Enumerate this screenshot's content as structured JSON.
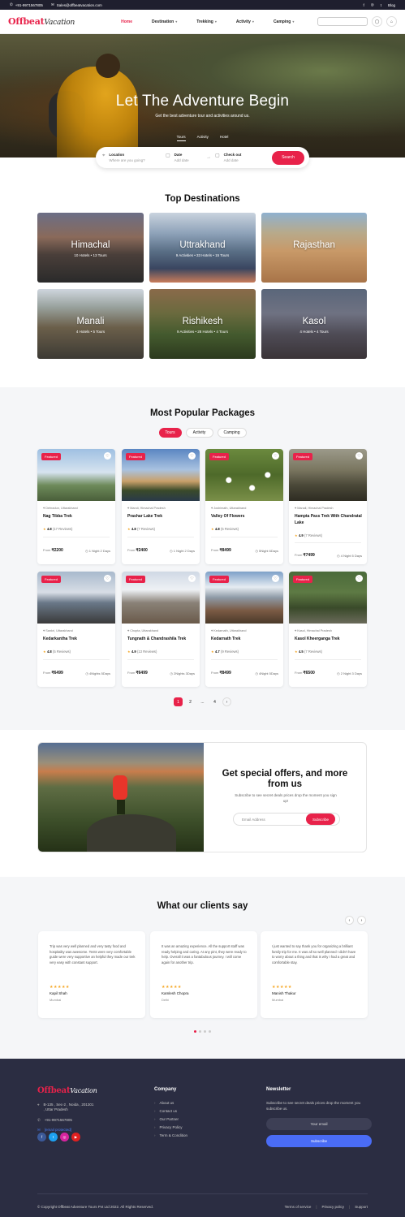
{
  "topbar": {
    "phone": "+91-9971567805",
    "email": "Sales@offbeatvacation.com",
    "social": [
      "f",
      "◎",
      "t"
    ],
    "blog": "Blog"
  },
  "nav": {
    "logo_main": "Offbeat",
    "logo_sub": "Vacation",
    "items": [
      {
        "label": "Home",
        "active": true
      },
      {
        "label": "Destination"
      },
      {
        "label": "Trekking"
      },
      {
        "label": "Activity"
      },
      {
        "label": "Camping"
      }
    ]
  },
  "hero": {
    "title": "Let The Adventure Begin",
    "subtitle": "Get the best adventure tour and activities around us.",
    "tabs": [
      "Tours",
      "Activity",
      "Hotel"
    ]
  },
  "search": {
    "location_label": "Location",
    "location_value": "Where are you going?",
    "date_label": "Date",
    "date_value": "Add date",
    "checkout_label": "Check out",
    "checkout_value": "Add date",
    "button": "Search"
  },
  "destinations": {
    "title": "Top Destinations",
    "items": [
      {
        "name": "Himachal",
        "meta": "10 Hotels  •  13 Tours"
      },
      {
        "name": "Uttrakhand",
        "meta": "9 Activities  •  33 Hotels  •  15 Tours"
      },
      {
        "name": "Rajasthan",
        "meta": ""
      },
      {
        "name": "Manali",
        "meta": "4 Hotels  •  5 Tours"
      },
      {
        "name": "Rishikesh",
        "meta": "9 Activities  •  28 Hotels  •  4 Tours"
      },
      {
        "name": "Kasol",
        "meta": "4 Hotels  •  4 Tours"
      }
    ]
  },
  "packages": {
    "title": "Most Popular Packages",
    "tabs": [
      "Tours",
      "Activity",
      "Camping"
    ],
    "featured_label": "Featured",
    "from_label": "From",
    "cards": [
      {
        "location": "Dehradun, Uttarakhand",
        "title": "Nag Tibba Trek",
        "rating": "4.8",
        "reviews": "(17 Reviews)",
        "price": "₹2200",
        "duration": "1 Night 2 Days"
      },
      {
        "location": "Mandi, Himachal Pradesh",
        "title": "Prashar Lake Trek",
        "rating": "4.8",
        "reviews": "(7 Reviews)",
        "price": "₹2400",
        "duration": "1 Night 2 Days"
      },
      {
        "location": "Joshimath, Uttarakhand",
        "title": "Valley Of Flowers",
        "rating": "4.8",
        "reviews": "(5 Reviews)",
        "price": "₹8499",
        "duration": "5Night 6Days"
      },
      {
        "location": "Manali, Himachal Pradesh",
        "title": "Hampta Pass Trek With Chandratal Lake",
        "rating": "4.9",
        "reviews": "(7 Reviews)",
        "price": "₹7499",
        "duration": "4 Night 5 Days"
      },
      {
        "location": "Sankri, Uttarakhand",
        "title": "Kedarkantha Trek",
        "rating": "4.8",
        "reviews": "(5 Reviews)",
        "price": "₹6499",
        "duration": "4Nights 5Days"
      },
      {
        "location": "Chopta, Uttarakhand",
        "title": "Tungnath & Chandrashila Trek",
        "rating": "4.9",
        "reviews": "(13 Reviews)",
        "price": "₹6499",
        "duration": "2Nights 3Days"
      },
      {
        "location": "Kedarnath, Uttarakhand",
        "title": "Kedarnath Trek",
        "rating": "4.7",
        "reviews": "(9 Reviews)",
        "price": "₹8499",
        "duration": "4Night 5Days"
      },
      {
        "location": "Kasol, Himachal Pradesh",
        "title": "Kasol Kheerganga Trek",
        "rating": "4.5",
        "reviews": "(7 Reviews)",
        "price": "₹6500",
        "duration": "2 Night 3 Days"
      }
    ]
  },
  "pagination": [
    "1",
    "2",
    "...",
    "4",
    "›"
  ],
  "newsletter_box": {
    "title": "Get special offers, and more from us",
    "text": "Subscribe to see secret deals prices drop the moment you sign up!",
    "placeholder": "Email Address",
    "button": "Subscribe"
  },
  "testimonials": {
    "title": "What our clients say",
    "items": [
      {
        "text": "Trip was very well planned and very tasty food and hospitality was awesome. Tents were very comfortable guide were very supportive an helpful they made our trek very easy with constant support.",
        "name": "Kapil Shah",
        "city": "Mumbai"
      },
      {
        "text": "It was an amazing experience. All the support staff was ready helping and caring. At any pint, they were ready to help. Overall it was a fantabulous journey. I will come again for another trip.",
        "name": "Kamlesh Chopra",
        "city": "Delhi"
      },
      {
        "text": "I just wanted to say thank you for organizing a brilliant family trip for me. It was all so well planned I didn't have to worry about a thing and that is why I had a great and comfortable stay.",
        "name": "Manish Thakur",
        "city": "Mumbai"
      }
    ],
    "stars": "★★★★★"
  },
  "footer": {
    "address": "B-135 , Sec-2 , Noida , 201301 , Uttar Pradesh",
    "phone": "+91-9971567805",
    "email": "[email protected]",
    "social": [
      "f",
      "t",
      "◎",
      "▶"
    ],
    "company_title": "Company",
    "company_links": [
      "About us",
      "Contact us",
      "Our Partner",
      "Privacy Policy",
      "Term & Condition"
    ],
    "newsletter_title": "Newsletter",
    "newsletter_text": "Subscribe to see secret deals prices drop the moment you subscribe us.",
    "email_placeholder": "Your email",
    "subscribe": "Subscribe",
    "copyright": "© Copyright Offbeat Adventure Tours Pvt Ltd 2022. All Rights Reserved.",
    "bottom_links": [
      "Terms of service",
      "Privacy policy",
      "Support"
    ]
  },
  "colors": {
    "accent": "#e8224a",
    "footer_bg": "#2b2d42",
    "button_blue": "#4a6cf5"
  }
}
